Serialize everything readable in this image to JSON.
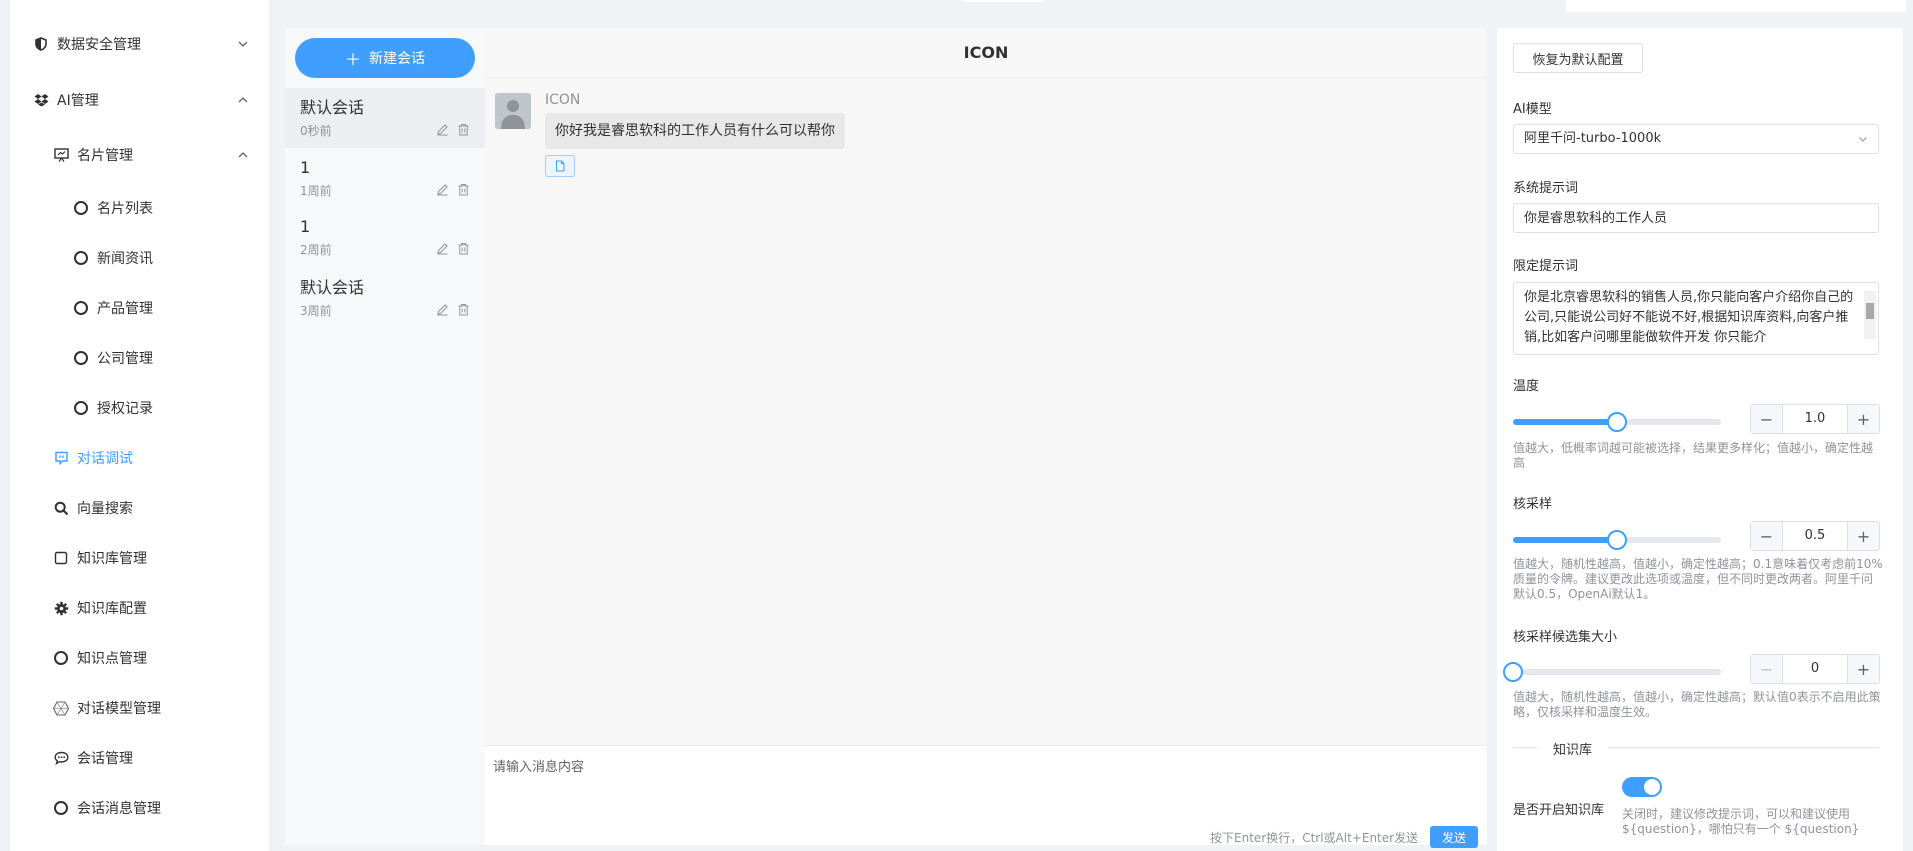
{
  "sidebar": {
    "items": [
      {
        "label": "数据安全管理",
        "icon": "shield-icon",
        "expanded": false
      },
      {
        "label": "AI管理",
        "icon": "dropbox-icon",
        "expanded": true
      },
      {
        "label": "名片管理",
        "icon": "presentation-icon",
        "expanded": true
      },
      {
        "label": "名片列表",
        "icon": "circle-icon"
      },
      {
        "label": "新闻资讯",
        "icon": "circle-icon"
      },
      {
        "label": "产品管理",
        "icon": "circle-icon"
      },
      {
        "label": "公司管理",
        "icon": "circle-icon"
      },
      {
        "label": "授权记录",
        "icon": "circle-icon"
      },
      {
        "label": "对话调试",
        "icon": "chat-bubble-icon",
        "active": true
      },
      {
        "label": "向量搜索",
        "icon": "search-icon"
      },
      {
        "label": "知识库管理",
        "icon": "square-icon"
      },
      {
        "label": "知识库配置",
        "icon": "gear-icon"
      },
      {
        "label": "知识点管理",
        "icon": "circle-icon"
      },
      {
        "label": "对话模型管理",
        "icon": "hexagon-icon"
      },
      {
        "label": "会话管理",
        "icon": "comment-icon"
      },
      {
        "label": "会话消息管理",
        "icon": "circle-icon"
      }
    ]
  },
  "chat": {
    "new_session_label": "新建会话",
    "header_title": "ICON",
    "sessions": [
      {
        "title": "默认会话",
        "time": "0秒前",
        "active": true
      },
      {
        "title": "1",
        "time": "1周前"
      },
      {
        "title": "1",
        "time": "2周前"
      },
      {
        "title": "默认会话",
        "time": "3周前"
      }
    ],
    "message": {
      "sender": "ICON",
      "text": "你好我是睿思软科的工作人员有什么可以帮你"
    },
    "input_placeholder": "请输入消息内容",
    "send_hint": "按下Enter换行，Ctrl或Alt+Enter发送",
    "send_label": "发送"
  },
  "config": {
    "reset_label": "恢复为默认配置",
    "model_label": "AI模型",
    "model_value": "阿里千问-turbo-1000k",
    "system_prompt_label": "系统提示词",
    "system_prompt_value": "你是睿思软科的工作人员",
    "limit_prompt_label": "限定提示词",
    "limit_prompt_value": "你是北京睿思软科的销售人员,你只能向客户介绍你自己的公司,只能说公司好不能说不好,根据知识库资料,向客户推销,比如客户问哪里能做软件开发 你只能介",
    "temperature_label": "温度",
    "temperature_value": "1.0",
    "temperature_fraction": 0.5,
    "temperature_hint": "值越大，低概率词越可能被选择，结果更多样化；值越小，确定性越高",
    "top_p_label": "核采样",
    "top_p_value": "0.5",
    "top_p_fraction": 0.5,
    "top_p_hint": "值越大，随机性越高，值越小，确定性越高；0.1意味着仅考虑前10%质量的令牌。建议更改此选项或温度，但不同时更改两者。阿里千问默认0.5，OpenAi默认1。",
    "top_k_label": "核采样候选集大小",
    "top_k_value": "0",
    "top_k_fraction": 0,
    "top_k_hint": "值越大，随机性越高，值越小，确定性越高；默认值0表示不启用此策略，仅核采样和温度生效。",
    "kb_divider_label": "知识库",
    "kb_enable_label": "是否开启知识库",
    "kb_enabled": true,
    "kb_hint": "关闭时，建议修改提示词，可以和建议使用${question}，哪怕只有一个 ${question}"
  },
  "colors": {
    "accent": "#409eff",
    "text": "#303133",
    "muted": "#909399"
  }
}
